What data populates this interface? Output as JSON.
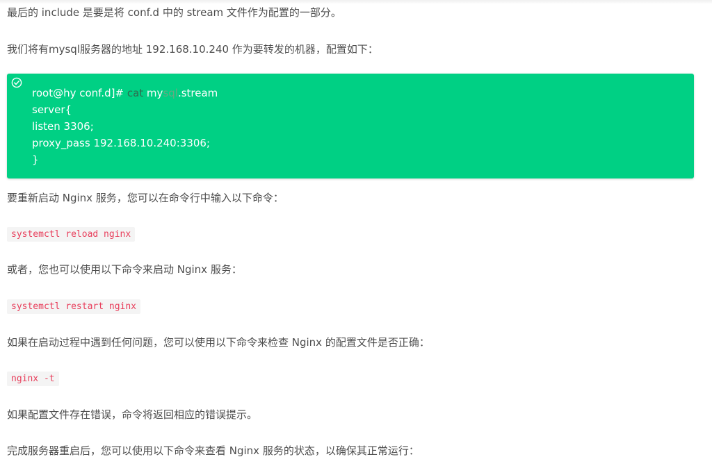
{
  "paragraphs": {
    "p1": "最后的 include 是要是将 conf.d 中的 stream 文件作为配置的一部分。",
    "p2": "我们将有mysql服务器的地址 192.168.10.240 作为要转发的机器，配置如下：",
    "p3": "要重新启动 Nginx 服务，您可以在命令行中输入以下命令：",
    "p4": "或者，您也可以使用以下命令来启动 Nginx 服务：",
    "p5": "如果在启动过程中遇到任何问题，您可以使用以下命令来检查 Nginx 的配置文件是否正确：",
    "p6": "如果配置文件存在错误，命令将返回相应的错误提示。",
    "p7": "完成服务器重启后，您可以使用以下命令来查看 Nginx 服务的状态，以确保其正常运行："
  },
  "code_block": {
    "icon": "check-circle-icon",
    "background": "#00d084",
    "line1": {
      "part_a": "root@hy conf.d]# ",
      "part_b": "cat",
      "part_c": " my",
      "part_d": "sql",
      "part_e": ".stream"
    },
    "line2": "server{",
    "line3": "listen 3306;",
    "line4": "proxy_pass 192.168.10.240:3306;",
    "line5": "}"
  },
  "commands": {
    "reload": "systemctl reload nginx",
    "restart": "systemctl restart nginx",
    "test": "nginx -t"
  }
}
